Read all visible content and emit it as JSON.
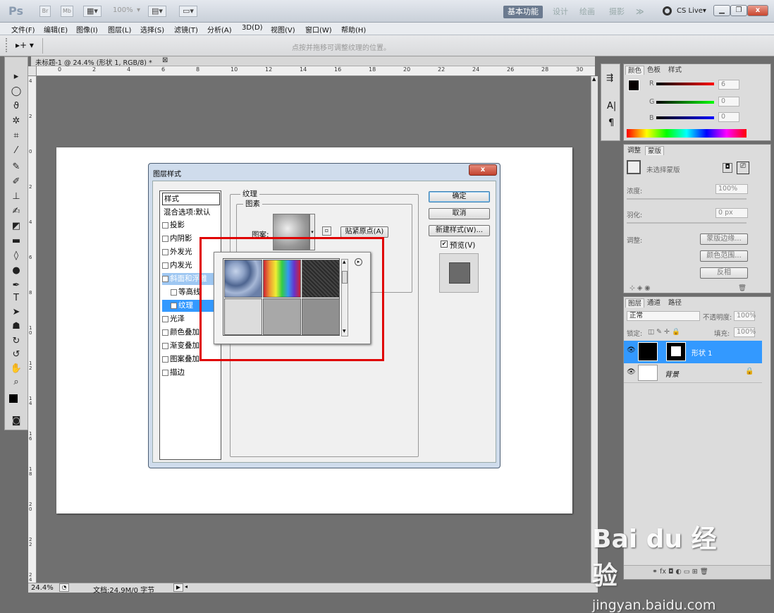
{
  "titlebar": {
    "app": "Ps",
    "zoom": "100%",
    "workspaces": [
      "基本功能",
      "设计",
      "绘画",
      "摄影"
    ],
    "more": "≫",
    "cslive": "CS Live▾",
    "btn_br": "Br",
    "btn_mb": "Mb"
  },
  "menu": [
    "文件(F)",
    "编辑(E)",
    "图像(I)",
    "图层(L)",
    "选择(S)",
    "滤镜(T)",
    "分析(A)",
    "3D(D)",
    "视图(V)",
    "窗口(W)",
    "帮助(H)"
  ],
  "options": {
    "hint": "点按并拖移可调整纹理的位置。"
  },
  "document": {
    "tab": "未标题-1 @ 24.4% (形状 1, RGB/8) *",
    "close": "⊠",
    "ruler_top": [
      "0",
      "2",
      "4",
      "6",
      "8",
      "10",
      "12",
      "14",
      "16",
      "18",
      "20",
      "22",
      "24",
      "26",
      "28",
      "30"
    ],
    "ruler_left": [
      "4",
      "2",
      "0",
      "2",
      "4",
      "6",
      "8",
      "1 0",
      "1 2",
      "1 4",
      "1 6",
      "1 8",
      "2 0",
      "2 2",
      "2 4"
    ]
  },
  "status": {
    "zoom": "24.4%",
    "doc": "文档:24.9M/0 字节"
  },
  "dialog": {
    "title": "图层样式",
    "close": "x",
    "styles_header": "样式",
    "blend_options": "混合选项:默认",
    "items": [
      {
        "label": "投影",
        "checked": false
      },
      {
        "label": "内阴影",
        "checked": false
      },
      {
        "label": "外发光",
        "checked": false
      },
      {
        "label": "内发光",
        "checked": false
      },
      {
        "label": "斜面和浮雕",
        "checked": true
      },
      {
        "label": "等高线",
        "checked": false
      },
      {
        "label": "纹理",
        "checked": true
      },
      {
        "label": "光泽",
        "checked": false
      },
      {
        "label": "颜色叠加",
        "checked": false
      },
      {
        "label": "渐变叠加",
        "checked": false
      },
      {
        "label": "图案叠加",
        "checked": false
      },
      {
        "label": "描边",
        "checked": false
      }
    ],
    "section": "纹理",
    "group": "图素",
    "pattern_label": "图案:",
    "snap_button": "贴紧原点(A)",
    "ok": "确定",
    "cancel": "取消",
    "new_style": "新建样式(W)...",
    "preview": "预览(V)",
    "preview_checked": true
  },
  "picker": {
    "arrow": "▸"
  },
  "color_panel": {
    "tabs": [
      "颜色",
      "色板",
      "样式"
    ],
    "r": "6",
    "g": "0",
    "b": "0",
    "r_label": "R",
    "g_label": "G",
    "b_label": "B"
  },
  "adjust_panel": {
    "tabs": [
      "调整",
      "蒙版"
    ],
    "no_mask": "未选择蒙版",
    "density_label": "浓度:",
    "density": "100%",
    "feather_label": "羽化:",
    "feather": "0 px",
    "refine_label": "调整:",
    "btn_edge": "蒙版边缘...",
    "btn_range": "颜色范围...",
    "btn_invert": "反相"
  },
  "layers_panel": {
    "tabs": [
      "图层",
      "通道",
      "路径"
    ],
    "blend": "正常",
    "opacity_label": "不透明度:",
    "opacity": "100%",
    "lock_label": "锁定:",
    "fill_label": "填充:",
    "fill": "100%",
    "layers": [
      {
        "name": "形状 1",
        "selected": true
      },
      {
        "name": "背景",
        "selected": false,
        "locked": true
      }
    ]
  },
  "watermark": {
    "logo": "Bai du 经验",
    "url": "jingyan.baidu.com"
  }
}
